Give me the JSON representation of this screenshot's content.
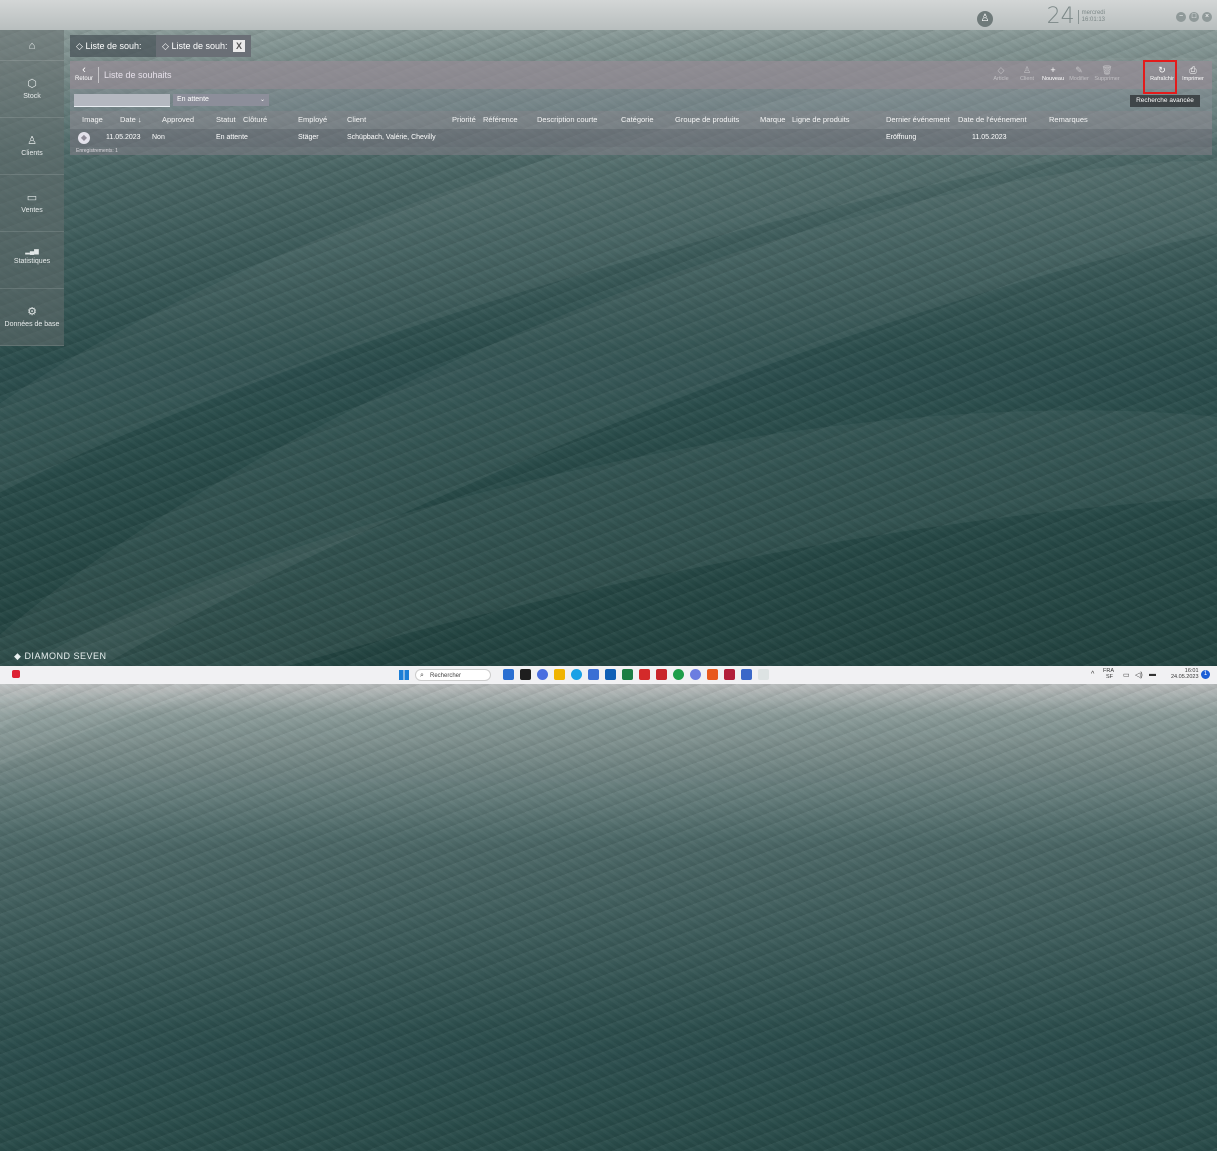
{
  "header": {
    "day": "24",
    "weekday": "mercredi",
    "time": "16:01:13",
    "user_icon": "person-icon"
  },
  "tabs": [
    {
      "label": "Liste de souh:",
      "active": false
    },
    {
      "label": "Liste de souh:",
      "active": true,
      "close": "X"
    }
  ],
  "sidebar": {
    "items": [
      {
        "label": "",
        "icon": "home-icon",
        "glyph": "⌂"
      },
      {
        "label": "Stock",
        "icon": "box-icon",
        "glyph": "⬡"
      },
      {
        "label": "Clients",
        "icon": "person-icon",
        "glyph": "♙"
      },
      {
        "label": "Ventes",
        "icon": "register-icon",
        "glyph": "▭"
      },
      {
        "label": "Statistiques",
        "icon": "bar-chart-icon",
        "glyph": "▂▄▆"
      },
      {
        "label": "Données de base",
        "icon": "gear-icon",
        "glyph": "⚙"
      }
    ]
  },
  "toolbar": {
    "back_label": "Retour",
    "title": "Liste de souhaits",
    "buttons": [
      {
        "label": "Article",
        "icon": "diamond-icon",
        "glyph": "◇",
        "enabled": false
      },
      {
        "label": "Client",
        "icon": "person-icon",
        "glyph": "♙",
        "enabled": false
      },
      {
        "label": "Nouveau",
        "icon": "plus-icon",
        "glyph": "+",
        "enabled": true
      },
      {
        "label": "Modifier",
        "icon": "pencil-icon",
        "glyph": "✎",
        "enabled": false
      },
      {
        "label": "Supprimer",
        "icon": "trash-icon",
        "glyph": "🗑",
        "enabled": false
      },
      {
        "label": "Rafraîchir",
        "icon": "refresh-icon",
        "glyph": "↻",
        "enabled": true
      },
      {
        "label": "Imprimer",
        "icon": "printer-icon",
        "glyph": "⎙",
        "enabled": true
      }
    ]
  },
  "filter": {
    "search_value": "",
    "status_value": "En attente",
    "advanced_label": "Recherche avancée"
  },
  "grid": {
    "columns": [
      "Image",
      "Date ↓",
      "Approved",
      "Statut",
      "Clôturé",
      "Employé",
      "Client",
      "Priorité",
      "Référence",
      "Description courte",
      "Catégorie",
      "Groupe de produits",
      "Marque",
      "Ligne de produits",
      "Dernier événement",
      "Date de l'événement",
      "Remarques"
    ],
    "rows": [
      {
        "date": "11.05.2023",
        "approved": "Non",
        "status": "En attente",
        "closed": "",
        "employee": "Stäger",
        "client": "Schüpbach, Valérie, Chevilly",
        "last_event": "Eröffnung",
        "event_date": "11.05.2023"
      }
    ],
    "footer": "Enregistrements: 1"
  },
  "brand": "DIAMOND SEVEN",
  "taskbar": {
    "search_placeholder": "Rechercher",
    "lang": "FRA",
    "lang_sub": "SF",
    "time": "16:01",
    "date": "24.05.2023"
  },
  "colors": {
    "highlight": "#e31b1b",
    "toolbar": "#968c96"
  }
}
